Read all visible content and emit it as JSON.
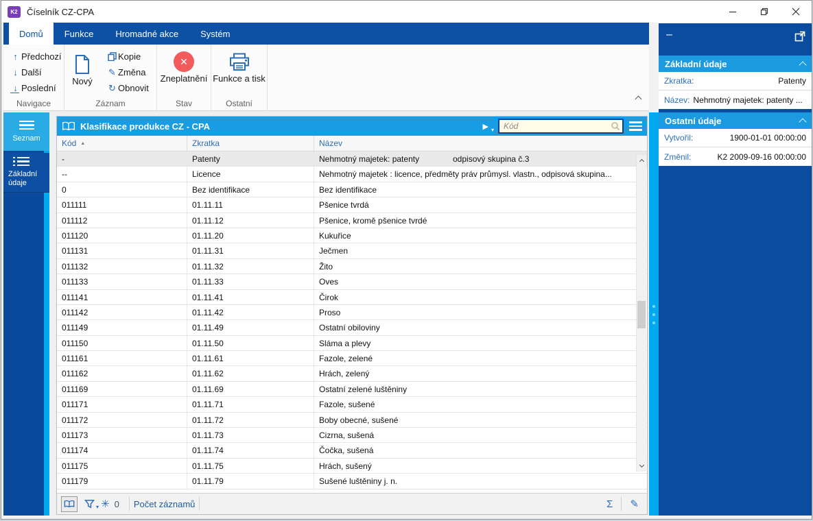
{
  "window": {
    "title": "Číselník CZ-CPA",
    "logo": "K2"
  },
  "tabs": [
    {
      "label": "Domů",
      "active": true
    },
    {
      "label": "Funkce",
      "active": false
    },
    {
      "label": "Hromadné akce",
      "active": false
    },
    {
      "label": "Systém",
      "active": false
    }
  ],
  "ribbon": {
    "navigace": {
      "label": "Navigace",
      "items": [
        {
          "label": "Předchozí"
        },
        {
          "label": "Další"
        },
        {
          "label": "Poslední"
        }
      ]
    },
    "zaznam": {
      "label": "Záznam",
      "big_label": "Nový",
      "items": [
        {
          "label": "Kopie"
        },
        {
          "label": "Změna"
        },
        {
          "label": "Obnovit"
        }
      ]
    },
    "stav": {
      "label": "Stav",
      "big_label": "Zneplatnění"
    },
    "ostatni": {
      "label": "Ostatní",
      "big_label": "Funkce a tisk"
    }
  },
  "rail": {
    "items": [
      {
        "label": "Seznam"
      },
      {
        "label_line1": "Základní",
        "label_line2": "údaje"
      }
    ]
  },
  "table": {
    "title": "Klasifikace produkce CZ - CPA",
    "search_placeholder": "Kód",
    "columns": [
      "Kód",
      "Zkratka",
      "Název"
    ],
    "rows": [
      {
        "kod": "-",
        "zkratka": "Patenty",
        "nazev": "Nehmotný majetek: patenty",
        "nazev2": "odpisový skupina č.3",
        "selected": true
      },
      {
        "kod": "--",
        "zkratka": "Licence",
        "nazev": "Nehmotný majetek : licence, předměty práv průmysl. vlastn., odpisová skupina..."
      },
      {
        "kod": "0",
        "zkratka": "Bez identifikace",
        "nazev": "Bez identifikace"
      },
      {
        "kod": "011111",
        "zkratka": "01.11.11",
        "nazev": "Pšenice tvrdá"
      },
      {
        "kod": "011112",
        "zkratka": "01.11.12",
        "nazev": "Pšenice, kromě pšenice tvrdé"
      },
      {
        "kod": "011120",
        "zkratka": "01.11.20",
        "nazev": "Kukuřice"
      },
      {
        "kod": "011131",
        "zkratka": "01.11.31",
        "nazev": "Ječmen"
      },
      {
        "kod": "011132",
        "zkratka": "01.11.32",
        "nazev": "Žito"
      },
      {
        "kod": "011133",
        "zkratka": "01.11.33",
        "nazev": "Oves"
      },
      {
        "kod": "011141",
        "zkratka": "01.11.41",
        "nazev": "Čirok"
      },
      {
        "kod": "011142",
        "zkratka": "01.11.42",
        "nazev": "Proso"
      },
      {
        "kod": "011149",
        "zkratka": "01.11.49",
        "nazev": "Ostatní obiloviny"
      },
      {
        "kod": "011150",
        "zkratka": "01.11.50",
        "nazev": "Sláma a plevy"
      },
      {
        "kod": "011161",
        "zkratka": "01.11.61",
        "nazev": "Fazole, zelené"
      },
      {
        "kod": "011162",
        "zkratka": "01.11.62",
        "nazev": "Hrách, zelený"
      },
      {
        "kod": "011169",
        "zkratka": "01.11.69",
        "nazev": "Ostatní zelené luštěniny"
      },
      {
        "kod": "011171",
        "zkratka": "01.11.71",
        "nazev": "Fazole, sušené"
      },
      {
        "kod": "011172",
        "zkratka": "01.11.72",
        "nazev": "Boby obecné, sušené"
      },
      {
        "kod": "011173",
        "zkratka": "01.11.73",
        "nazev": "Cizrna, sušená"
      },
      {
        "kod": "011174",
        "zkratka": "01.11.74",
        "nazev": "Čočka, sušená"
      },
      {
        "kod": "011175",
        "zkratka": "01.11.75",
        "nazev": "Hrách, sušený"
      },
      {
        "kod": "011179",
        "zkratka": "01.11.79",
        "nazev": "Sušené luštěniny j. n."
      }
    ],
    "statusbar": {
      "count_value": "0",
      "count_label": "Počet záznamů"
    }
  },
  "sidepanel": {
    "sections": [
      {
        "title": "Základní údaje",
        "rows": [
          {
            "label": "Zkratka:",
            "value": "Patenty"
          },
          {
            "label": "Název:",
            "value": "Nehmotný majetek: patenty  ..."
          }
        ]
      },
      {
        "title": "Ostatní údaje",
        "rows": [
          {
            "label": "Vytvořil:",
            "value": "1900-01-01 00:00:00"
          },
          {
            "label": "Změnil:",
            "value": "K2 2009-09-16 00:00:00"
          }
        ]
      }
    ]
  },
  "icons": {
    "arrow_up": "↑",
    "arrow_down": "↓",
    "refresh": "↻",
    "pencil": "✎",
    "sigma": "Σ",
    "asterisk": "✳",
    "close_x": "✕",
    "sort_asc": "▲",
    "play": "▶",
    "caret_down": "▾",
    "dash": "–"
  },
  "colors": {
    "ribbon_blue": "#0c51a4",
    "panel_blue": "#0a4c9e",
    "cyan": "#00a9ee",
    "title_blue": "#189ce4",
    "section_blue": "#1b9ae0",
    "icon_blue": "#2a6db9",
    "danger_red": "#f15b5b",
    "search_bg": "#fffbe6",
    "selected_row": "#e9e9e9"
  }
}
